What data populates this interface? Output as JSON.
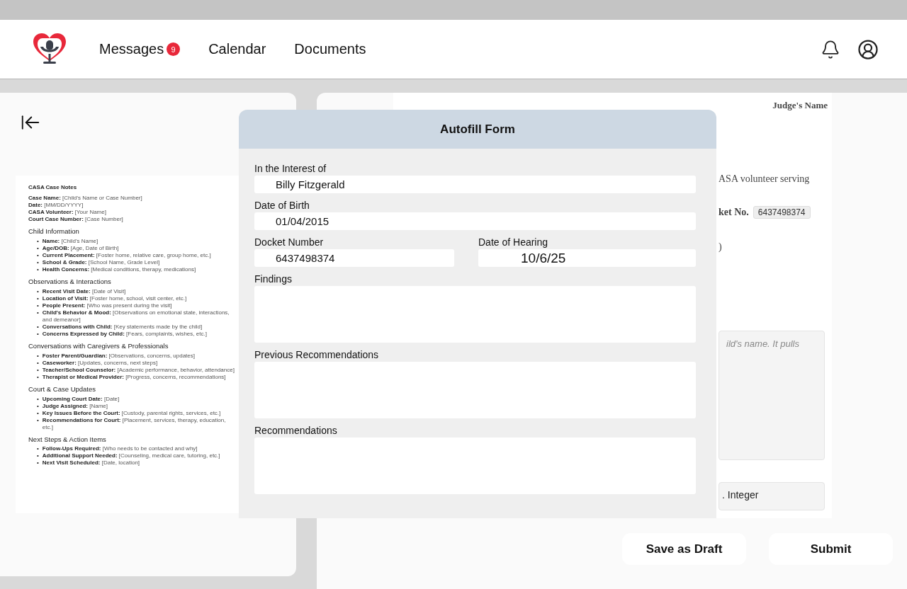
{
  "nav": {
    "items": [
      {
        "label": "Messages",
        "badge": "9"
      },
      {
        "label": "Calendar"
      },
      {
        "label": "Documents"
      }
    ]
  },
  "left_document": {
    "title": "CASA Case Notes",
    "marker": "•",
    "meta": [
      "**Case Name:** [Child's Name or Case Number]",
      "**Date:** [MM/DD/YYYY]",
      "**CASA Volunteer:** [Your Name]",
      "**Court Case Number:** [Case Number]"
    ],
    "sections": [
      {
        "heading": "Child Information",
        "items": [
          "**Name:** [Child's Name]",
          "**Age/DOB:** [Age, Date of Birth]",
          "**Current Placement:** [Foster home, relative care, group home, etc.]",
          "**School & Grade:** [School Name, Grade Level]",
          "**Health Concerns:** [Medical conditions, therapy, medications]"
        ]
      },
      {
        "heading": "Observations & Interactions",
        "items": [
          "**Recent Visit Date:** [Date of Visit]",
          "**Location of Visit:** [Foster home, school, visit center, etc.]",
          "**People Present:** [Who was present during the visit]",
          "**Child's Behavior & Mood:** [Observations on emotional state, interactions, and demeanor]",
          "**Conversations with Child:** [Key statements made by the child]",
          "**Concerns Expressed by Child:** [Fears, complaints, wishes, etc.]"
        ]
      },
      {
        "heading": "Conversations with Caregivers & Professionals",
        "items": [
          "**Foster Parent/Guardian:** [Observations, concerns, updates]",
          "**Caseworker:** [Updates, concerns, next steps]",
          "**Teacher/School Counselor:** [Academic performance, behavior, attendance]",
          "**Therapist or Medical Provider:** [Progress, concerns, recommendations]"
        ]
      },
      {
        "heading": "Court & Case Updates",
        "items": [
          "**Upcoming Court Date:** [Date]",
          "**Judge Assigned:** [Name]",
          "**Key Issues Before the Court:** [Custody, parental rights, services, etc.]",
          "**Recommendations for Court:** [Placement, services, therapy, education, etc.]"
        ]
      },
      {
        "heading": "Next Steps & Action Items",
        "items": [
          "**Follow-Ups Required:** [Who needs to be contacted and why]",
          "**Additional Support Needed:** [Counseling, medical care, tutoring, etc.]",
          "**Next Visit Scheduled:** [Date, location]"
        ]
      }
    ]
  },
  "right_document": {
    "judge": "Judge's Name",
    "line_1": "ASA volunteer serving",
    "docket_label": "ket No.",
    "docket_value": "6437498374",
    "line_3": ")",
    "box_1_placeholder": "ild's name. It pulls",
    "box_2_text": ". Integer"
  },
  "modal": {
    "title": "Autofill Form",
    "fields": [
      {
        "kind": "line",
        "label": "In the Interest of",
        "value": "Billy Fitzgerald"
      },
      {
        "kind": "line",
        "label": "Date of Birth",
        "value": "01/04/2015"
      },
      {
        "kind": "pair",
        "items": [
          {
            "label": "Docket Number",
            "value": "6437498374"
          },
          {
            "label": "Date of Hearing",
            "value": "10/6/25"
          }
        ]
      },
      {
        "kind": "area",
        "label": "Findings"
      },
      {
        "kind": "area",
        "label": "Previous Recommendations"
      },
      {
        "kind": "area",
        "label": "Recommendations"
      }
    ]
  },
  "buttons": [
    "Save as Draft",
    "Submit"
  ]
}
